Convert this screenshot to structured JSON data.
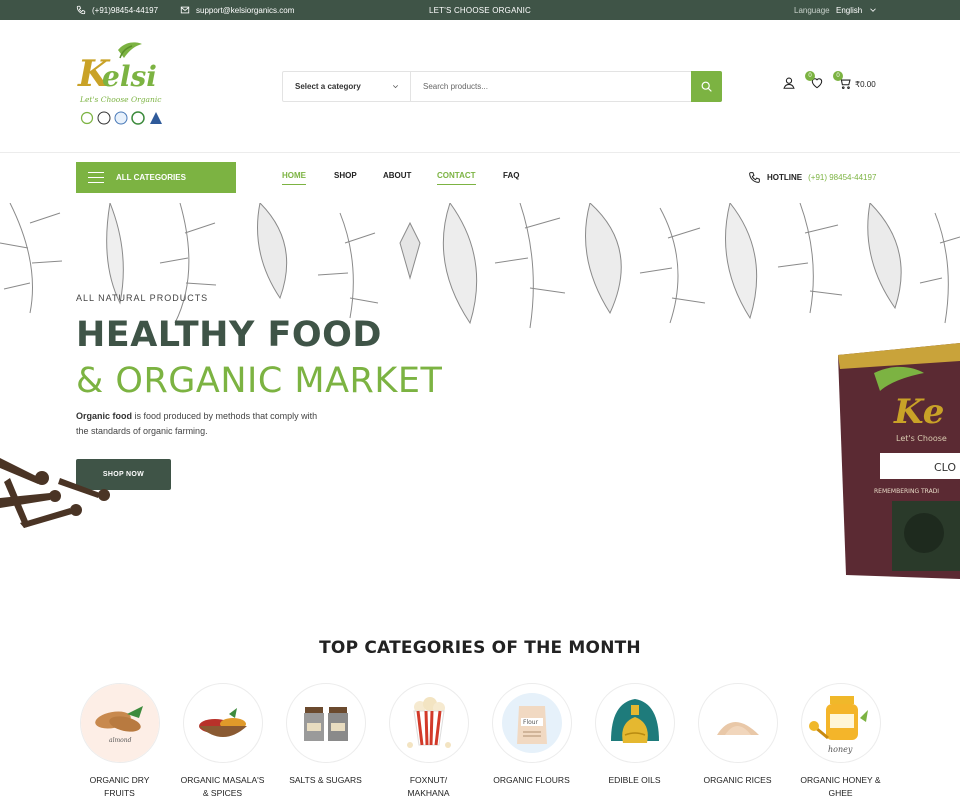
{
  "topbar": {
    "phone": "(+91)98454-44197",
    "email": "support@kelsiorganics.com",
    "promo": "LET'S CHOOSE ORGANIC",
    "language_label": "Language",
    "language_value": "English"
  },
  "brand": {
    "name": "Kelsi",
    "tagline": "Let's Choose Organic"
  },
  "search": {
    "category_label": "Select a category",
    "placeholder": "Search products..."
  },
  "header_icons": {
    "wishlist_count": "0",
    "cart_count": "0",
    "cart_total": "₹0.00"
  },
  "nav": {
    "all_categories": "ALL CATEGORIES",
    "links": [
      "HOME",
      "SHOP",
      "ABOUT",
      "CONTACT",
      "FAQ"
    ],
    "hotline_label": "HOTLINE",
    "hotline_number": "(+91) 98454-44197"
  },
  "hero": {
    "eyebrow": "ALL NATURAL PRODUCTS",
    "title_line1": "HEALTHY FOOD",
    "title_line2": "& ORGANIC MARKET",
    "desc_bold": "Organic food",
    "desc_line1": " is food produced by methods that comply with",
    "desc_line2": "the standards of organic farming.",
    "cta": "SHOP NOW"
  },
  "categories": {
    "title": "TOP CATEGORIES OF THE MONTH",
    "items": [
      {
        "line1": "ORGANIC DRY",
        "line2": "FRUITS"
      },
      {
        "line1": "ORGANIC MASALA'S",
        "line2": "& SPICES"
      },
      {
        "line1": "SALTS & SUGARS",
        "line2": ""
      },
      {
        "line1": "FOXNUT/",
        "line2": "MAKHANA"
      },
      {
        "line1": "ORGANIC FLOURS",
        "line2": ""
      },
      {
        "line1": "EDIBLE OILS",
        "line2": ""
      },
      {
        "line1": "ORGANIC RICES",
        "line2": ""
      },
      {
        "line1": "ORGANIC HONEY &",
        "line2": "GHEE"
      }
    ],
    "image_labels": {
      "almond": "almond",
      "flour": "Flour",
      "honey": "honey"
    }
  },
  "colors": {
    "brand_dark": "#3f5447",
    "brand_green": "#7cb342"
  }
}
